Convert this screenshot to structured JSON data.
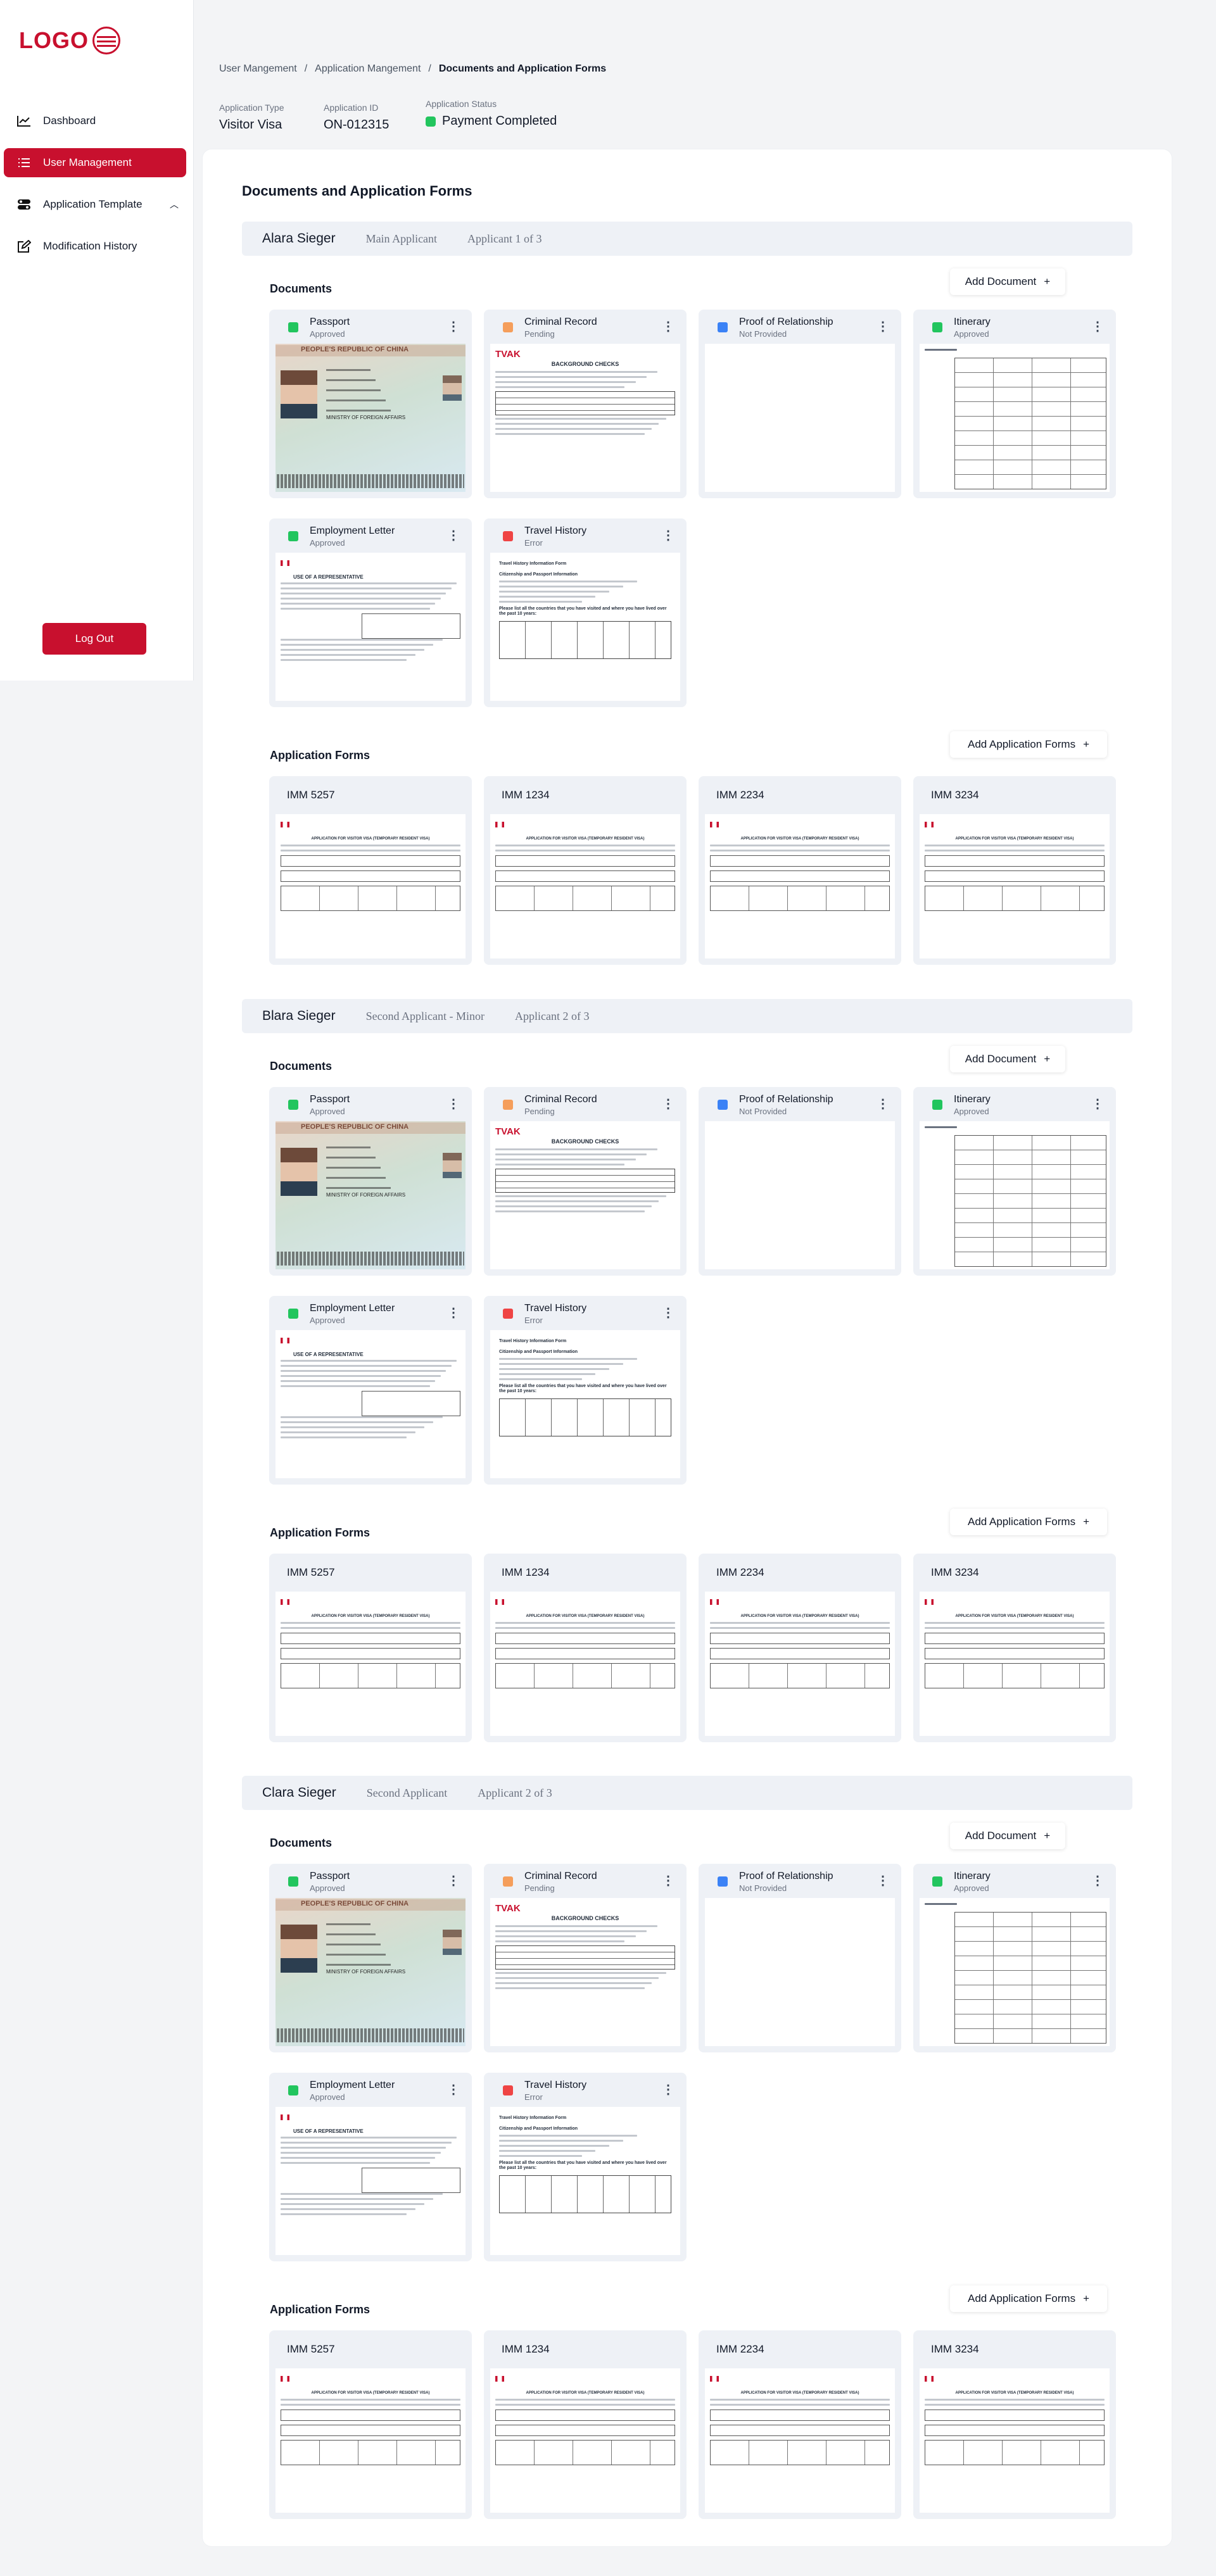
{
  "brand": {
    "logo_text": "LOGO",
    "accent": "#c8102e"
  },
  "sidebar": {
    "items": [
      {
        "label": "Dashboard",
        "icon": "chart-line-icon"
      },
      {
        "label": "User Management",
        "icon": "list-icon",
        "active": true
      },
      {
        "label": "Application Template",
        "icon": "toggle-icon",
        "expanded": true
      },
      {
        "label": "Modification History",
        "icon": "edit-icon"
      }
    ],
    "logout": "Log Out"
  },
  "breadcrumb": [
    "User Mangement",
    "Application Mangement",
    "Documents and Application Forms"
  ],
  "meta": {
    "type_label": "Application Type",
    "type_value": "Visitor Visa",
    "id_label": "Application ID",
    "id_value": "ON-012315",
    "status_label": "Application Status",
    "status_value": "Payment Completed",
    "status_color": "#22c55e"
  },
  "panel_title": "Documents and Application Forms",
  "labels": {
    "documents": "Documents",
    "application_forms": "Application Forms",
    "add_document": "Add Document",
    "add_application_forms": "Add Application Forms",
    "plus": "+"
  },
  "status_colors": {
    "Approved": "#22c55e",
    "Pending": "#f59e5b",
    "Not Provided": "#3b82f6",
    "Error": "#ef4444"
  },
  "applicants": [
    {
      "name": "Alara Sieger",
      "role": "Main Applicant",
      "index": "Applicant 1 of 3"
    },
    {
      "name": "Blara Sieger",
      "role": "Second Applicant - Minor",
      "index": "Applicant 2 of 3"
    },
    {
      "name": "Clara Sieger",
      "role": "Second Applicant",
      "index": "Applicant 2 of 3"
    }
  ],
  "documents": [
    {
      "title": "Passport",
      "status": "Approved",
      "preview": "passport"
    },
    {
      "title": "Criminal Record",
      "status": "Pending",
      "preview": "criminal"
    },
    {
      "title": "Proof of Relationship",
      "status": "Not Provided",
      "preview": "empty"
    },
    {
      "title": "Itinerary",
      "status": "Approved",
      "preview": "itinerary"
    },
    {
      "title": "Employment Letter",
      "status": "Approved",
      "preview": "employment"
    },
    {
      "title": "Travel History",
      "status": "Error",
      "preview": "travel"
    }
  ],
  "forms": [
    "IMM 5257",
    "IMM 1234",
    "IMM 2234",
    "IMM 3234"
  ],
  "preview_text": {
    "criminal_logo": "TVAK",
    "criminal_title": "BACKGROUND CHECKS",
    "travel_title": "Travel History Information Form",
    "travel_sub": "Citizenship and Passport Information",
    "travel_q": "Please list all the countries that you have visited and where you have lived over the past 10 years:",
    "employment_title": "USE OF A REPRESENTATIVE",
    "imm_title": "APPLICATION FOR VISITOR VISA (TEMPORARY RESIDENT VISA)",
    "passport_header": "PEOPLE'S REPUBLIC OF CHINA",
    "passport_authority": "MINISTRY OF FOREIGN AFFAIRS"
  }
}
